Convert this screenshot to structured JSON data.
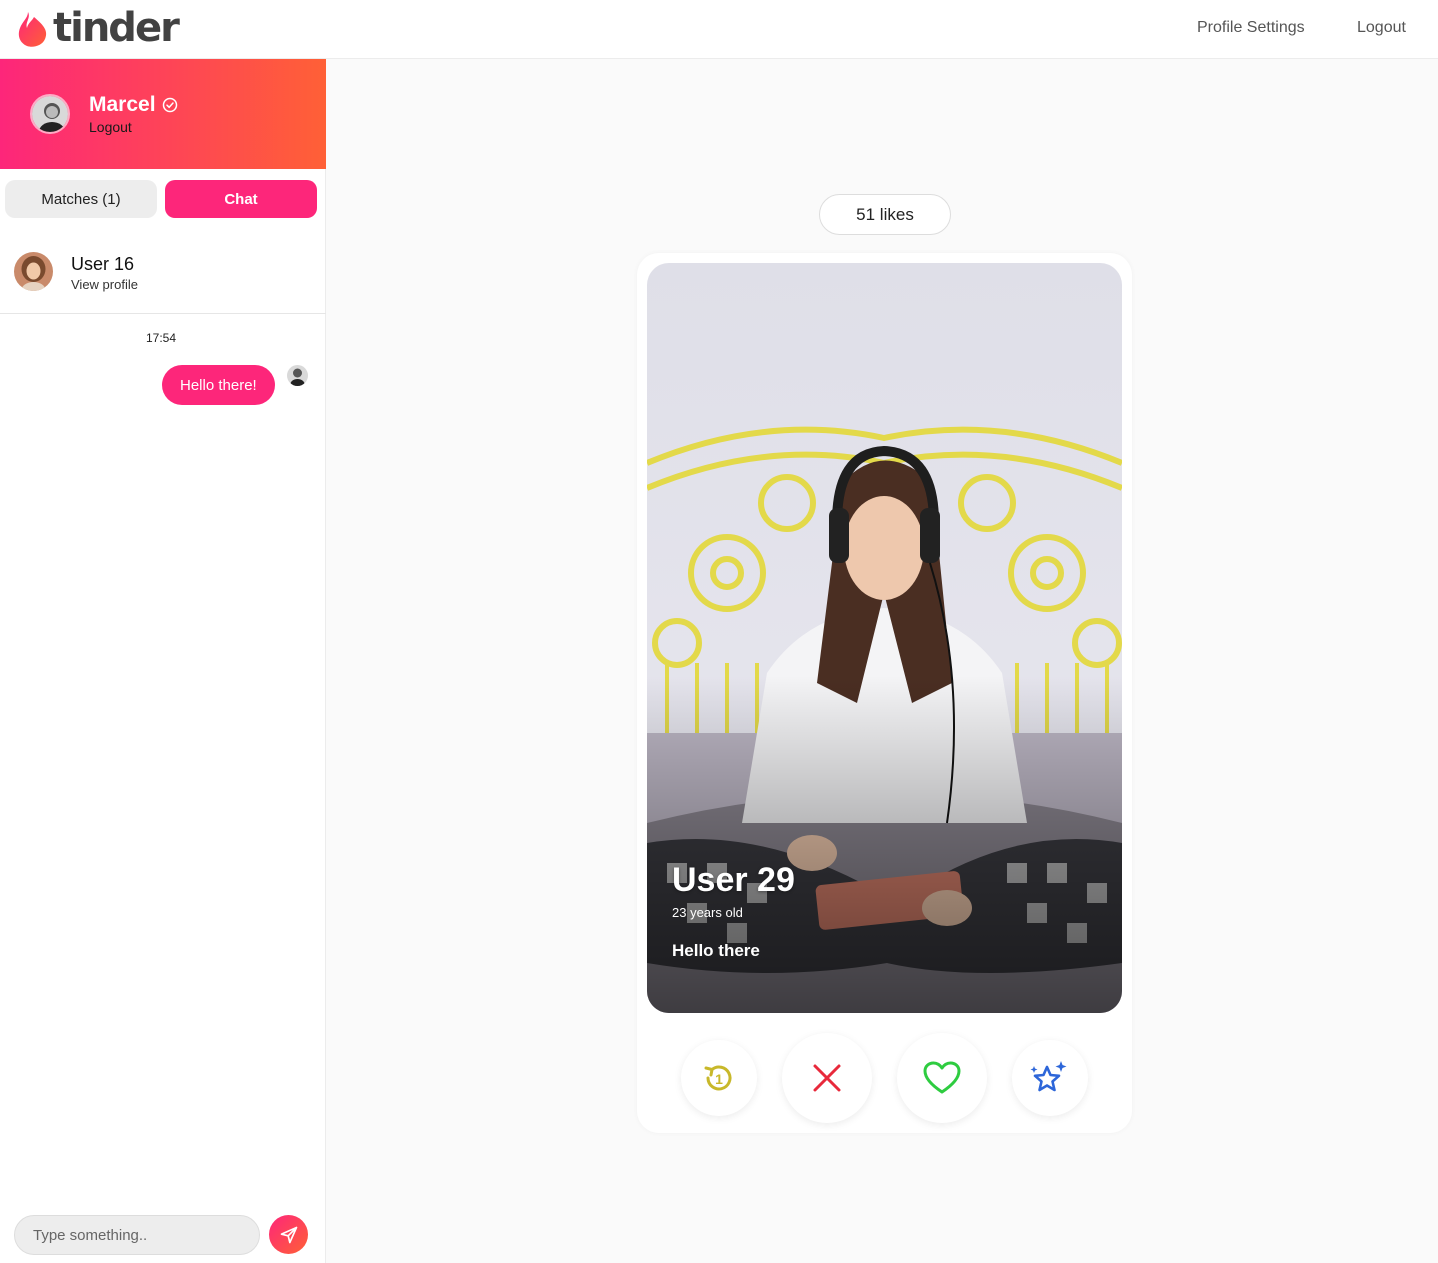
{
  "topbar": {
    "logo_text": "tinder",
    "nav": {
      "profile_settings": "Profile Settings",
      "logout": "Logout"
    }
  },
  "sidebar": {
    "profile": {
      "name": "Marcel",
      "logout": "Logout"
    },
    "tabs": {
      "matches": "Matches (1)",
      "chat": "Chat"
    },
    "active_match": {
      "name": "User 16",
      "subtitle": "View profile"
    },
    "messages": [
      {
        "time": "17:54",
        "text": "Hello there!"
      }
    ],
    "input": {
      "placeholder": "Type something.."
    }
  },
  "main": {
    "likes": "51 likes",
    "card": {
      "name": "User 29",
      "age": "23 years old",
      "bio": "Hello there"
    },
    "actions": [
      "rewind",
      "nope",
      "like",
      "super-like"
    ]
  },
  "colors": {
    "brand": "#fd267a",
    "brand_end": "#ff6036",
    "rewind": "#c8b82a",
    "nope": "#e8293b",
    "like": "#2ecc40",
    "super": "#2d66d9"
  }
}
